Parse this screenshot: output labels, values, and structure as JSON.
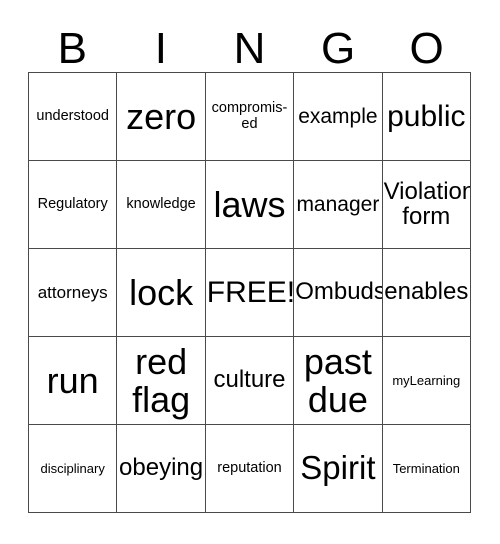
{
  "card": {
    "header_letters": [
      "B",
      "I",
      "N",
      "G",
      "O"
    ],
    "rows": [
      [
        {
          "text": "understood",
          "size": "fs-xxs"
        },
        {
          "text": "zero",
          "size": "fs-xxl"
        },
        {
          "text": "compromis-\ned",
          "size": "fs-xxs"
        },
        {
          "text": "example",
          "size": "fs-sm"
        },
        {
          "text": "public",
          "size": "fs-lg"
        }
      ],
      [
        {
          "text": "Regulatory",
          "size": "fs-xxs"
        },
        {
          "text": "knowledge",
          "size": "fs-xxs"
        },
        {
          "text": "laws",
          "size": "fs-xxl"
        },
        {
          "text": "manager",
          "size": "fs-sm"
        },
        {
          "text": "Violation\nform",
          "size": "fs-md"
        }
      ],
      [
        {
          "text": "attorneys",
          "size": "fs-xs"
        },
        {
          "text": "lock",
          "size": "fs-xxl"
        },
        {
          "text": "FREE!",
          "size": "fs-lg"
        },
        {
          "text": "Ombuds",
          "size": "fs-md"
        },
        {
          "text": "enables",
          "size": "fs-md"
        }
      ],
      [
        {
          "text": "run",
          "size": "fs-xxl"
        },
        {
          "text": "red\nflag",
          "size": "fs-xxl"
        },
        {
          "text": "culture",
          "size": "fs-md"
        },
        {
          "text": "past\ndue",
          "size": "fs-xxl"
        },
        {
          "text": "myLearning",
          "size": "fs-tiny"
        }
      ],
      [
        {
          "text": "disciplinary",
          "size": "fs-tiny"
        },
        {
          "text": "obeying",
          "size": "fs-md"
        },
        {
          "text": "reputation",
          "size": "fs-xxs"
        },
        {
          "text": "Spirit",
          "size": "fs-xl"
        },
        {
          "text": "Termination",
          "size": "fs-tiny"
        }
      ]
    ]
  },
  "colors": {
    "grid_line": "#4a4a4a",
    "text": "#000000",
    "background": "#ffffff"
  }
}
